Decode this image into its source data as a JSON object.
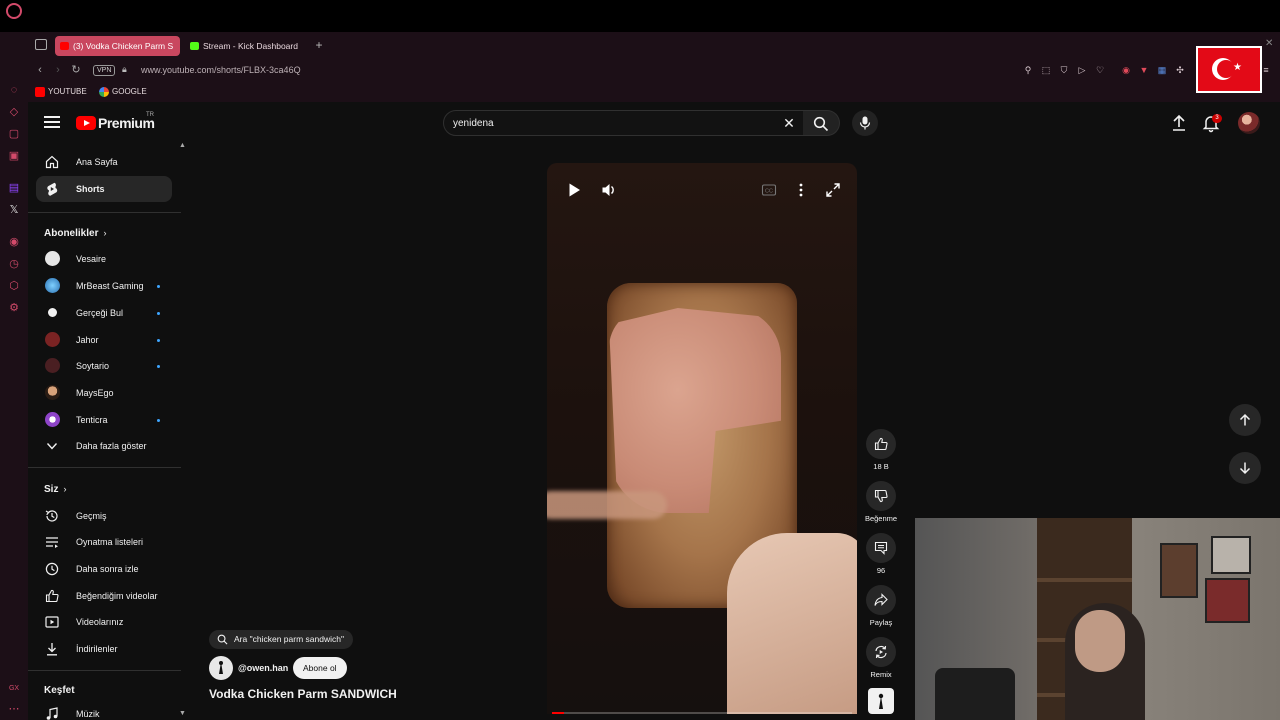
{
  "browser": {
    "tabs": [
      {
        "label": "(3) Vodka Chicken Parm S",
        "active": true
      },
      {
        "label": "Stream - Kick Dashboard",
        "active": false
      }
    ],
    "url": "www.youtube.com/shorts/FLBX-3ca46Q",
    "vpn_label": "VPN",
    "bookmarks": [
      {
        "label": "YOUTUBE"
      },
      {
        "label": "GOOGLE"
      }
    ]
  },
  "header": {
    "logo_text": "Premium",
    "country_code": "TR",
    "search_value": "yenidena",
    "notifications_count": "3"
  },
  "sidebar": {
    "main": [
      {
        "label": "Ana Sayfa",
        "icon": "home-icon"
      },
      {
        "label": "Shorts",
        "icon": "shorts-icon",
        "active": true
      }
    ],
    "subscriptions_title": "Abonelikler",
    "subscriptions": [
      {
        "label": "Vesaire",
        "new": false
      },
      {
        "label": "MrBeast Gaming",
        "new": true
      },
      {
        "label": "Gerçeği Bul",
        "new": true
      },
      {
        "label": "Jahor",
        "new": true
      },
      {
        "label": "Soytario",
        "new": true
      },
      {
        "label": "MaysEgo",
        "new": false
      },
      {
        "label": "Tenticra",
        "new": true
      }
    ],
    "show_more": "Daha fazla göster",
    "you_title": "Siz",
    "you": [
      {
        "label": "Geçmiş",
        "icon": "history-icon"
      },
      {
        "label": "Oynatma listeleri",
        "icon": "playlist-icon"
      },
      {
        "label": "Daha sonra izle",
        "icon": "clock-icon"
      },
      {
        "label": "Beğendiğim videolar",
        "icon": "thumbs-up-icon"
      },
      {
        "label": "Videolarınız",
        "icon": "video-icon"
      },
      {
        "label": "İndirilenler",
        "icon": "download-icon"
      }
    ],
    "explore_title": "Keşfet",
    "explore": [
      {
        "label": "Müzik",
        "icon": "music-icon"
      }
    ]
  },
  "short": {
    "search_suggestion": "Ara \"chicken parm sandwich\"",
    "channel": "@owen.han",
    "subscribe_label": "Abone ol",
    "title": "Vodka Chicken Parm SANDWICH",
    "progress_fraction": 0.04,
    "actions": {
      "like_count": "18 B",
      "dislike_label": "Beğenme",
      "comment_count": "96",
      "share_label": "Paylaş",
      "remix_label": "Remix"
    }
  },
  "colors": {
    "brand_red": "#ff0000",
    "opera_tab": "#c9475f",
    "browser_chrome": "#1c0f17",
    "background": "#0f0f0f"
  }
}
